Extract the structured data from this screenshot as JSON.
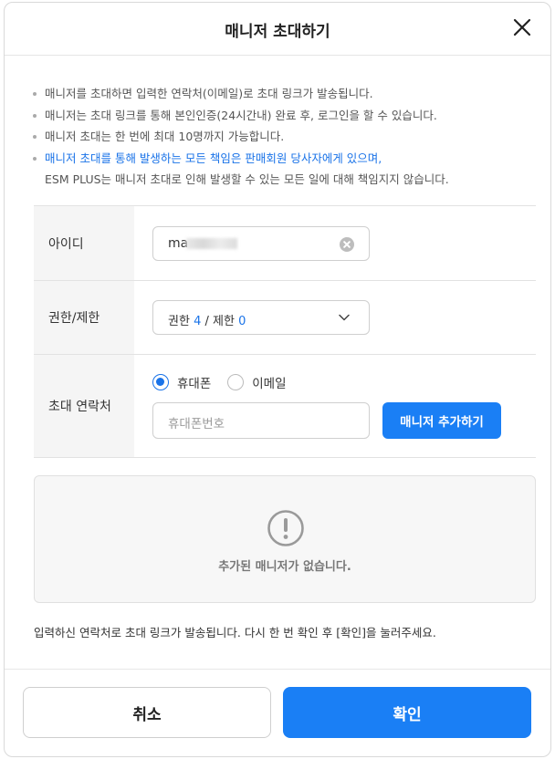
{
  "dialog": {
    "title": "매니저 초대하기"
  },
  "notes": [
    "매니저를 초대하면 입력한 연락처(이메일)로 초대 링크가 발송됩니다.",
    "매니저는 초대 링크를 통해 본인인증(24시간내) 완료 후, 로그인을 할 수 있습니다.",
    "매니저 초대는 한 번에 최대 10명까지 가능합니다."
  ],
  "notice": {
    "line1": "매니저 초대를 통해 발생하는 모든 책임은 판매회원 당사자에게 있으며,",
    "line2": "ESM PLUS는 매니저 초대로 인해 발생할 수 있는 모든 일에 대해 책임지지 않습니다."
  },
  "form": {
    "id_label": "아이디",
    "id_value": "ma",
    "permission_label": "권한/제한",
    "permission_prefix": "권한",
    "permission_count": "4",
    "separator": " / ",
    "restriction_prefix": "제한",
    "restriction_count": "0",
    "contact_label": "초대 연락처",
    "radio_phone": "휴대폰",
    "radio_email": "이메일",
    "phone_placeholder": "휴대폰번호",
    "add_button": "매니저 추가하기"
  },
  "empty_state": {
    "text": "추가된 매니저가 없습니다."
  },
  "footer_note": "입력하신 연락처로 초대 링크가 발송됩니다. 다시 한 번 확인 후 [확인]을 눌러주세요.",
  "buttons": {
    "cancel": "취소",
    "confirm": "확인"
  },
  "colors": {
    "accent": "#1a7ff5",
    "link": "#1a73e8"
  }
}
